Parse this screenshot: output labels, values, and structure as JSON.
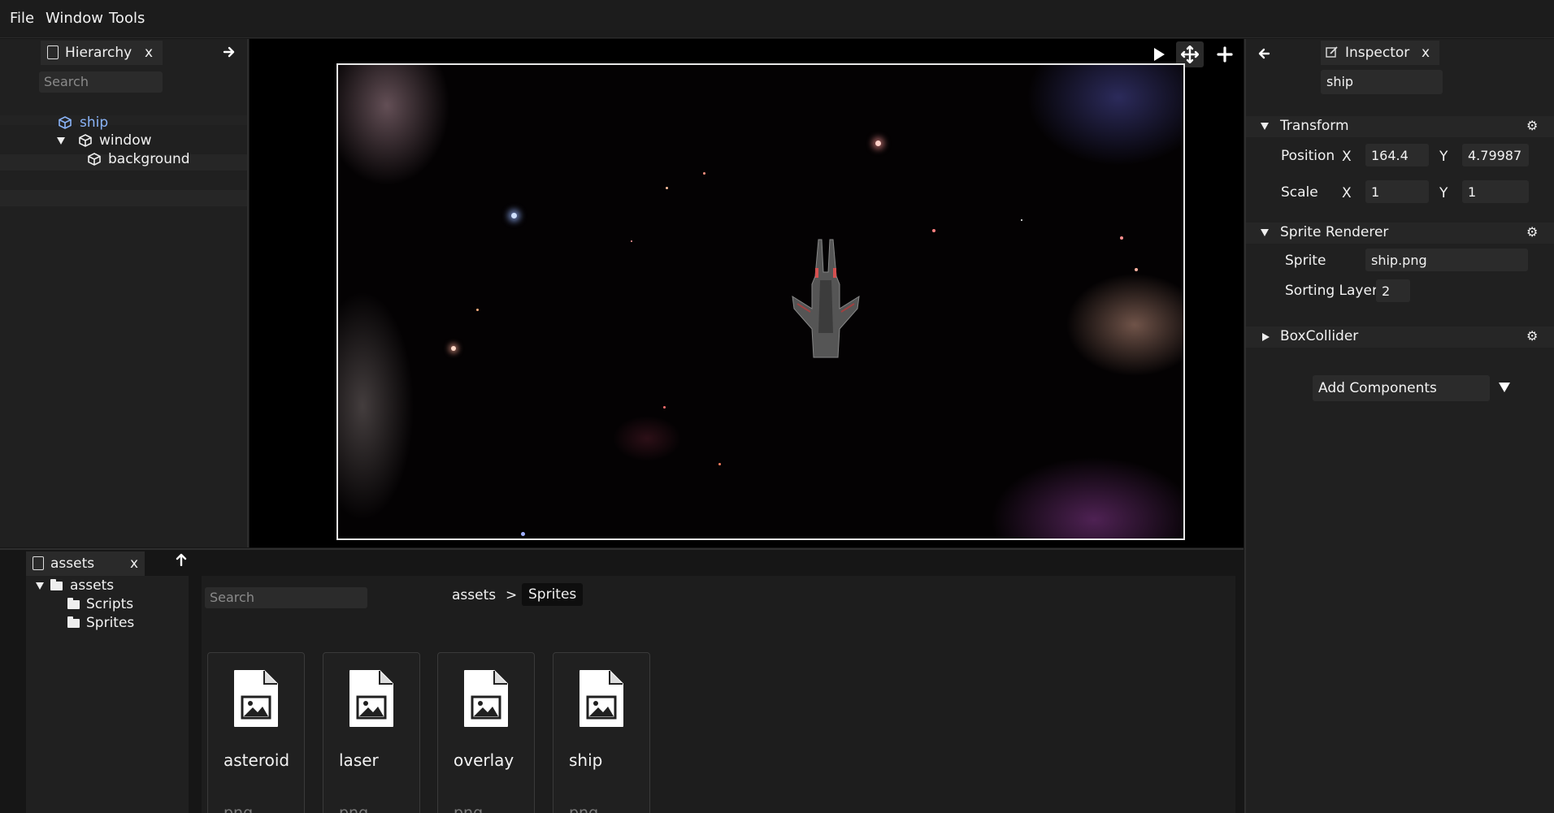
{
  "menu": {
    "file": "File",
    "window": "Window",
    "tools": "Tools"
  },
  "hierarchy": {
    "tab_label": "Hierarchy",
    "close": "x",
    "search_placeholder": "Search",
    "items": [
      {
        "label": "ship",
        "selected": true
      },
      {
        "label": "window",
        "expanded": true
      },
      {
        "label": "background"
      }
    ]
  },
  "viewport": {
    "tools": [
      "play-icon",
      "move-icon",
      "plus-icon"
    ],
    "colors": {
      "frame": "#e8e8e8",
      "background": "#000000"
    }
  },
  "inspector": {
    "tab_label": "Inspector",
    "close": "x",
    "object_name": "ship",
    "transform": {
      "title": "Transform",
      "position_label": "Position",
      "position_x_label": "X",
      "position_x": "164.4",
      "position_y_label": "Y",
      "position_y": "4.79987",
      "scale_label": "Scale",
      "scale_x_label": "X",
      "scale_x": "1",
      "scale_y_label": "Y",
      "scale_y": "1"
    },
    "sprite_renderer": {
      "title": "Sprite Renderer",
      "sprite_label": "Sprite",
      "sprite_value": "ship.png",
      "sorting_layer_label": "Sorting Layer",
      "sorting_layer_value": "2"
    },
    "box_collider": {
      "title": "BoxCollider"
    },
    "add_components": "Add Components"
  },
  "assets": {
    "tab_label": "assets",
    "close": "x",
    "tree": [
      {
        "label": "assets",
        "expanded": true
      },
      {
        "label": "Scripts"
      },
      {
        "label": "Sprites"
      }
    ],
    "search_placeholder": "Search",
    "breadcrumb": {
      "root": "assets",
      "separator": ">",
      "current": "Sprites"
    },
    "files": [
      {
        "name": "asteroid",
        "ext": "png"
      },
      {
        "name": "laser",
        "ext": "png"
      },
      {
        "name": "overlay",
        "ext": "png"
      },
      {
        "name": "ship",
        "ext": "png"
      }
    ]
  },
  "colors": {
    "selected_item": "#8ab4f8",
    "panel_bg": "#202020",
    "accent_text": "#f2f2f2"
  }
}
